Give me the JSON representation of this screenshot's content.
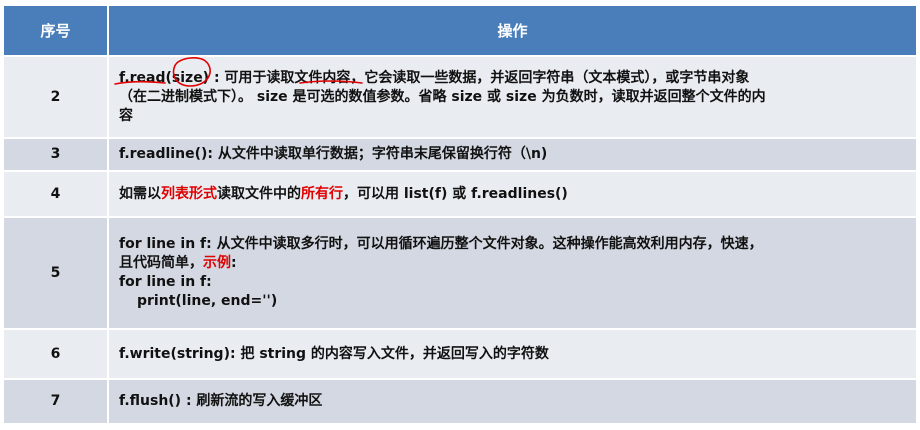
{
  "table": {
    "header": {
      "col1": "序号",
      "col2": "操作"
    },
    "rows": [
      {
        "num": "2",
        "desc": {
          "part1": "f.read(size) : 可用于读取文件内容，它会读取一些数据，并返回字符串（文本模式），或字节串对象",
          "part2": "（在二进制模式下）。 size 是可选的数值参数。省略 size 或 size 为负数时，读取并返回整个文件的内",
          "part3": "容"
        }
      },
      {
        "num": "3",
        "desc": "f.readline(): 从文件中读取单行数据；字符串末尾保留换行符（\\n)"
      },
      {
        "num": "4",
        "desc": {
          "t1": "如需以",
          "t2": "列表形式",
          "t3": "读取文件中的",
          "t4": "所有行",
          "t5": "，可以用 list(f) 或 f.readlines()"
        }
      },
      {
        "num": "5",
        "desc": {
          "line1": "for line in f: 从文件中读取多行时，可以用循环遍历整个文件对象。这种操作能高效利用内存，快速，",
          "line2a": "且代码简单，",
          "line2b": "示例",
          "line2c": ":",
          "line3": "for line in f:",
          "line4": "print(line, end='')"
        }
      },
      {
        "num": "6",
        "desc": "f.write(string): 把 string 的内容写入文件，并返回写入的字符数"
      },
      {
        "num": "7",
        "desc": "f.flush() : 刷新流的写入缓冲区"
      }
    ]
  },
  "colors": {
    "header_bg": "#4a7ebb",
    "row_light": "#e9ecf1",
    "row_dark": "#d3d8e2",
    "highlight": "#e00000"
  }
}
